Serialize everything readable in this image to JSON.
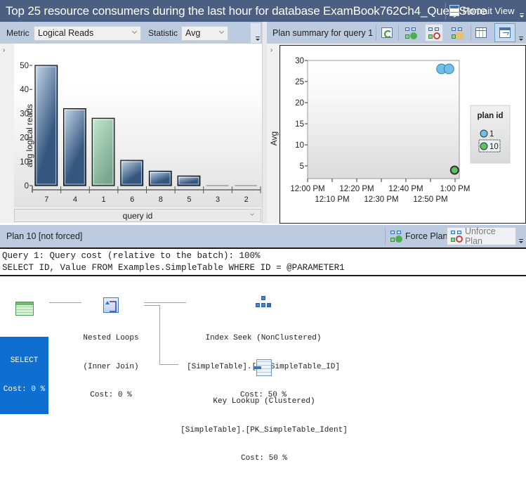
{
  "titlebar": {
    "title": "Top 25 resource consumers during the last hour for database ExamBook762Ch4_QueryStore",
    "portrait_view_label": "Portrait View"
  },
  "left_toolbar": {
    "metric_label": "Metric",
    "metric_value": "Logical Reads",
    "statistic_label": "Statistic",
    "statistic_value": "Avg"
  },
  "right_toolbar": {
    "plan_summary_label": "Plan summary for query 1",
    "buttons": [
      {
        "icon": "refresh-icon",
        "state": "normal"
      },
      {
        "icon": "force-plan-icon",
        "state": "normal"
      },
      {
        "icon": "unforce-plan-icon",
        "state": "pressed"
      },
      {
        "icon": "compare-plans-icon",
        "state": "normal"
      },
      {
        "icon": "grid-view-icon",
        "state": "normal"
      },
      {
        "icon": "chart-view-icon",
        "state": "active"
      }
    ]
  },
  "chart_data": [
    {
      "type": "bar",
      "title": "",
      "xlabel": "query id",
      "ylabel": "avg logical reads",
      "categories": [
        "7",
        "4",
        "1",
        "6",
        "8",
        "5",
        "3",
        "2"
      ],
      "values": [
        50,
        32,
        28,
        10.5,
        6,
        4,
        0,
        0
      ],
      "selected_category": "1",
      "ylim": [
        0,
        50
      ],
      "yticks": [
        0,
        10,
        20,
        30,
        40,
        50
      ],
      "colors": {
        "bar": "#35577f",
        "bar_light": "#c7d7ea",
        "selected": "#77a48c",
        "selected_light": "#c3e6d0"
      }
    },
    {
      "type": "scatter",
      "title": "",
      "xlabel": "",
      "ylabel": "Avg",
      "x_tick_labels": [
        "12:00 PM",
        "12:10 PM",
        "12:20 PM",
        "12:30 PM",
        "12:40 PM",
        "12:50 PM",
        "1:00 PM"
      ],
      "x_range_minutes": [
        0,
        60
      ],
      "yticks": [
        5,
        10,
        15,
        20,
        25,
        30
      ],
      "ylim": [
        2,
        30
      ],
      "legend_title": "plan id",
      "legend_position": "right",
      "series": [
        {
          "name": "1",
          "color": "#6ec0ea",
          "points": [
            {
              "x_minutes": 54.5,
              "y": 28
            },
            {
              "x_minutes": 57.5,
              "y": 28
            }
          ]
        },
        {
          "name": "10",
          "color": "#5bc45b",
          "points": [
            {
              "x_minutes": 59.8,
              "y": 4
            }
          ],
          "selected": true
        }
      ]
    }
  ],
  "plan_bar": {
    "title": "Plan 10 [not forced]",
    "force_plan_label": "Force Plan",
    "unforce_plan_label": "Unforce Plan"
  },
  "showplan": {
    "query_cost": "Query 1: Query cost (relative to the batch): 100%",
    "query_text": "SELECT ID, Value FROM Examples.SimpleTable WHERE ID = @PARAMETER1",
    "operators": {
      "select": {
        "name": "SELECT",
        "cost": "Cost: 0 %"
      },
      "nested_loops": {
        "name": "Nested Loops",
        "detail": "(Inner Join)",
        "cost": "Cost: 0 %"
      },
      "index_seek": {
        "name": "Index Seek (NonClustered)",
        "detail": "[SimpleTable].[ix_SimpleTable_ID]",
        "cost": "Cost: 50 %"
      },
      "key_lookup": {
        "name": "Key Lookup (Clustered)",
        "detail": "[SimpleTable].[PK_SimpleTable_Ident]",
        "cost": "Cost: 50 %"
      }
    }
  }
}
